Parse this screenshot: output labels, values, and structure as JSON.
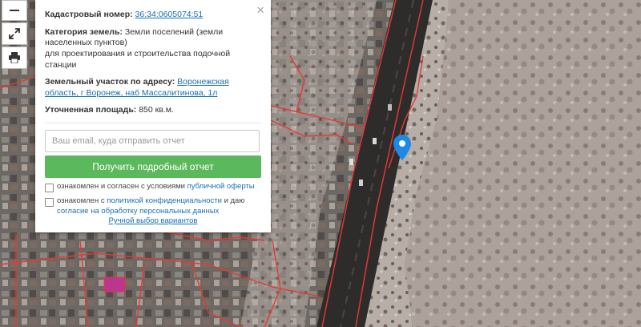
{
  "map": {
    "layers": [
      "satellite-imagery",
      "cadastral-boundaries"
    ],
    "accent_color": "#e53935"
  },
  "controls": {
    "zoom_out_icon": "minus-icon",
    "fullscreen_icon": "expand-icon",
    "print_icon": "printer-icon"
  },
  "popup": {
    "close_symbol": "×",
    "cadastral_label": "Кадастровый номер:",
    "cadastral_value": "36:34:0605074:51",
    "category_label": "Категория земель:",
    "category_value": "Земли поселений (земли населенных пунктов)",
    "category_purpose": "для проектирования и строительства подочной станции",
    "address_label": "Земельный участок по адресу:",
    "address_value": "Воронежская область, г Воронеж, наб Массалитинова, 1л",
    "area_label": "Уточненная площадь:",
    "area_value": "850 кв.м.",
    "email_placeholder": "Ваш email, куда отправить отчет",
    "report_button": "Получить подробный отчет",
    "consent1_prefix": "ознакомлен и согласен с условиями",
    "consent1_link": "публичной оферты",
    "consent2_prefix": "ознакомлен с",
    "consent2_link": "политикой конфиденциальности",
    "consent2_middle": "и даю",
    "consent2_link2": "согласие на обработку персональных данных",
    "manual_link": "Ручной выбор вариантов",
    "button_color": "#5cb85c",
    "link_color": "#1a6fb5"
  },
  "marker": {
    "icon": "map-pin-icon",
    "color": "#1e88e5"
  }
}
